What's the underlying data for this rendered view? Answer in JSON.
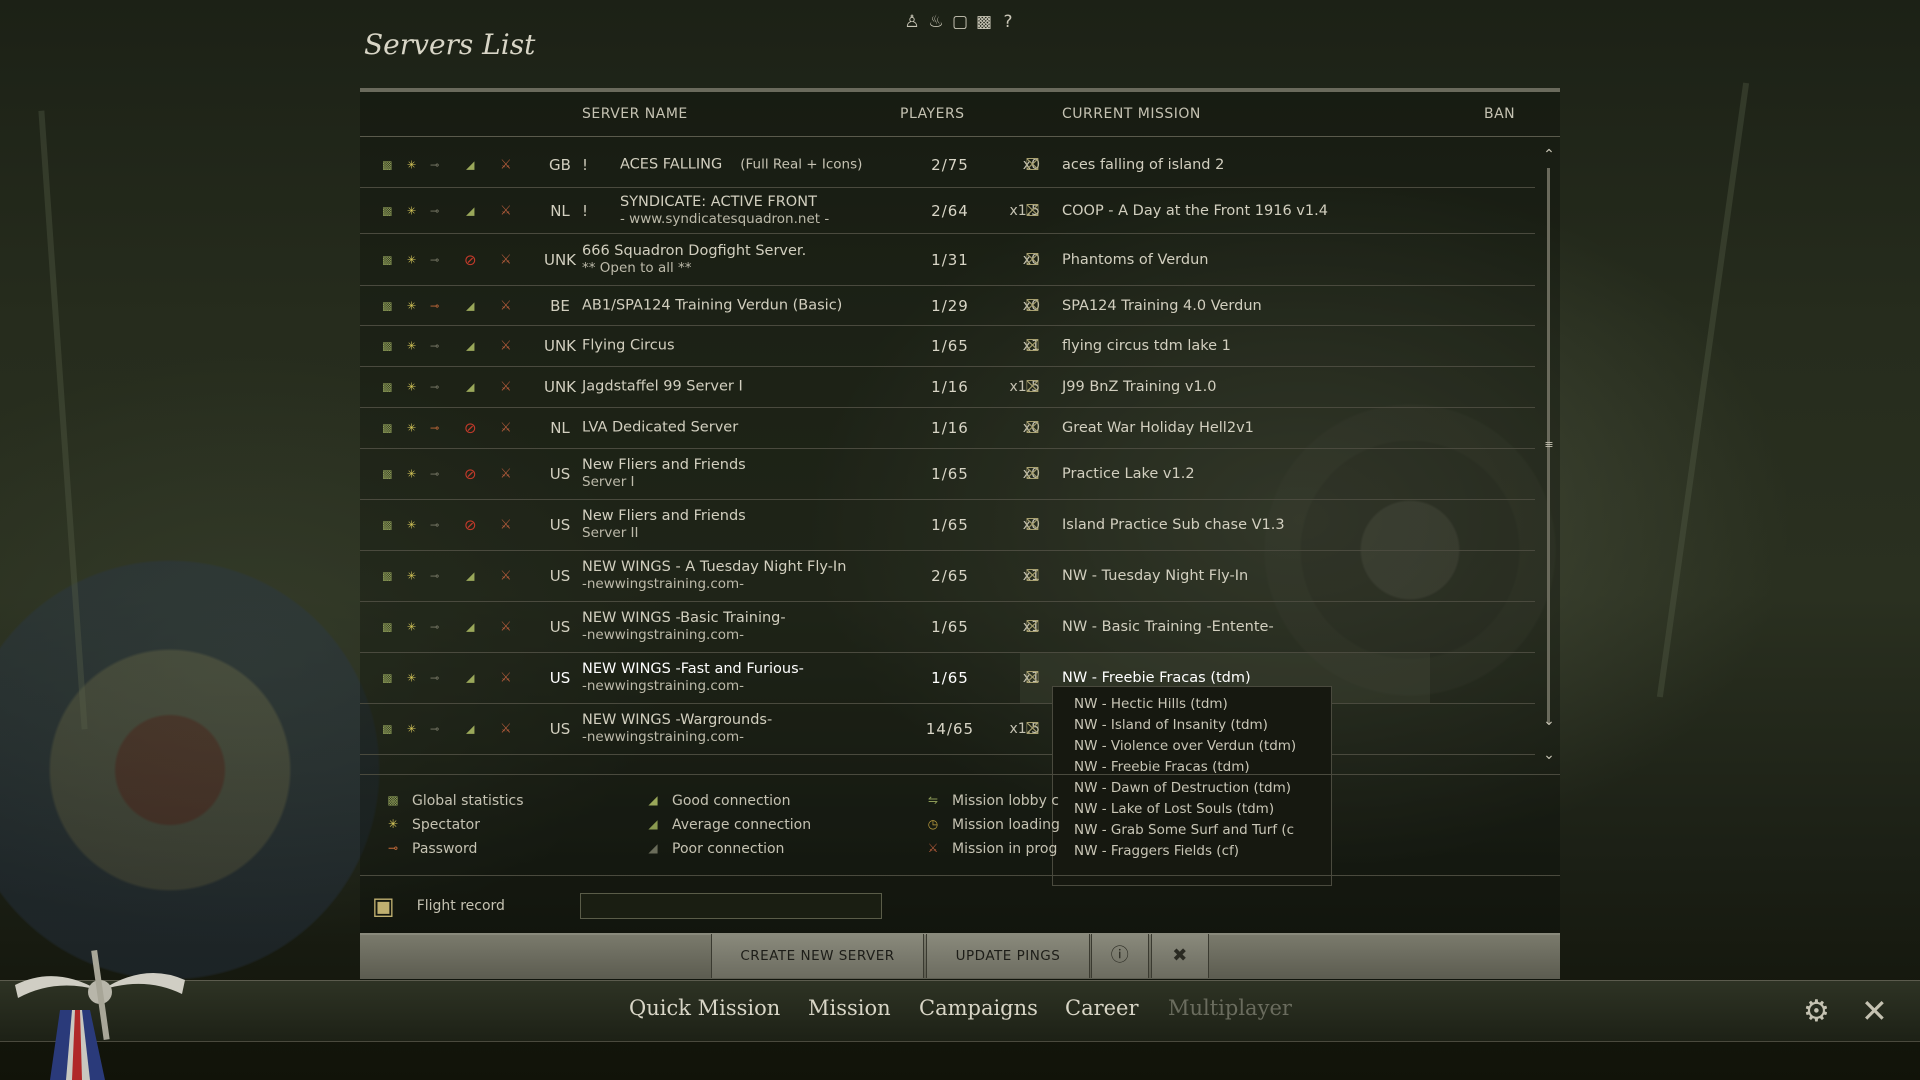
{
  "title": "Servers List",
  "top_icons": [
    "profile-icon",
    "rank-icon",
    "book-icon",
    "film-icon",
    "help-icon"
  ],
  "columns": {
    "server_name": "SERVER NAME",
    "players": "PLAYERS",
    "current_mission": "CURRENT MISSION",
    "ban": "BAN"
  },
  "rows": [
    {
      "country": "GB",
      "excl": "!",
      "name": "ACES FALLING",
      "extra": "(Full Real + Icons)",
      "players": "2/75",
      "mult": "x0",
      "mission": "aces falling of island 2",
      "pass": false,
      "ban": false
    },
    {
      "country": "NL",
      "excl": "!",
      "name": "SYNDICATE: ACTIVE FRONT",
      "line2": "-   www.syndicatesquadron.net   -",
      "players": "2/64",
      "mult": "x1.5",
      "mission": "COOP - A Day at the Front 1916 v1.4",
      "pass": false,
      "ban": false
    },
    {
      "country": "UNK",
      "name": "666 Squadron Dogfight Server.",
      "line2": "** Open to all **",
      "players": "1/31",
      "mult": "x0",
      "mission": "Phantoms of Verdun",
      "pass": false,
      "ban": true
    },
    {
      "country": "BE",
      "name": "AB1/SPA124 Training Verdun (Basic)",
      "players": "1/29",
      "mult": "x0",
      "mission": "SPA124 Training 4.0 Verdun",
      "pass": true,
      "ban": false
    },
    {
      "country": "UNK",
      "name": "Flying Circus",
      "players": "1/65",
      "mult": "x1",
      "mission": "flying circus tdm lake 1",
      "pass": false,
      "ban": false
    },
    {
      "country": "UNK",
      "name": "Jagdstaffel 99 Server I",
      "players": "1/16",
      "mult": "x1.5",
      "mission": "J99 BnZ Training v1.0",
      "pass": false,
      "ban": false
    },
    {
      "country": "NL",
      "name": "LVA Dedicated Server",
      "players": "1/16",
      "mult": "x0",
      "mission": "Great War Holiday Hell2v1",
      "pass": true,
      "ban": true
    },
    {
      "country": "US",
      "name": "New Fliers and Friends",
      "line2": "Server I",
      "players": "1/65",
      "mult": "x0",
      "mission": "Practice Lake v1.2",
      "pass": false,
      "ban": true
    },
    {
      "country": "US",
      "name": "New Fliers and Friends",
      "line2": "Server II",
      "players": "1/65",
      "mult": "x0",
      "mission": "Island Practice Sub chase V1.3",
      "pass": false,
      "ban": true
    },
    {
      "country": "US",
      "name": "NEW WINGS - A Tuesday Night Fly-In",
      "line2": "-newwingstraining.com-",
      "players": "2/65",
      "mult": "x1",
      "mission": "NW - Tuesday Night Fly-In",
      "pass": false,
      "ban": false
    },
    {
      "country": "US",
      "name": "NEW WINGS -Basic Training-",
      "line2": "-newwingstraining.com-",
      "players": "1/65",
      "mult": "x1",
      "mission": "NW - Basic Training -Entente-",
      "pass": false,
      "ban": false
    },
    {
      "country": "US",
      "name": "NEW WINGS -Fast and Furious-",
      "line2": "-newwingstraining.com-",
      "players": "1/65",
      "mult": "x1",
      "mission": "NW - Freebie Fracas (tdm)",
      "pass": false,
      "ban": false,
      "selected": true
    },
    {
      "country": "US",
      "name": "NEW WINGS -Wargrounds-",
      "line2": "-newwingstraining.com-",
      "players": "14/65",
      "mult": "x1.5",
      "mission": "",
      "pass": false,
      "ban": false
    }
  ],
  "mission_dropdown": [
    "NW - Hectic Hills (tdm)",
    "NW - Island of Insanity (tdm)",
    "NW - Violence over Verdun (tdm)",
    "NW - Freebie Fracas (tdm)",
    "NW - Dawn of Destruction (tdm)",
    "NW - Lake of Lost Souls (tdm)",
    "NW - Grab Some Surf and Turf (c",
    "NW - Fraggers Fields (cf)"
  ],
  "legend": {
    "global_stats": "Global statistics",
    "spectator": "Spectator",
    "password": "Password",
    "good": "Good connection",
    "average": "Average connection",
    "poor": "Poor connection",
    "lobby": "Mission lobby c",
    "loading": "Mission loading",
    "progress": "Mission in prog"
  },
  "flight_record": {
    "label": "Flight record",
    "value": ""
  },
  "buttons": {
    "create": "CREATE NEW SERVER",
    "update": "UPDATE PINGS"
  },
  "nav": {
    "quick": "Quick Mission",
    "mission": "Mission",
    "campaigns": "Campaigns",
    "career": "Career",
    "multiplayer": "Multiplayer"
  },
  "colors": {
    "accent": "#c9c6b6",
    "connection_good": "#9aa85a",
    "ban": "#c43a2a",
    "spectator": "#d6c75a"
  }
}
